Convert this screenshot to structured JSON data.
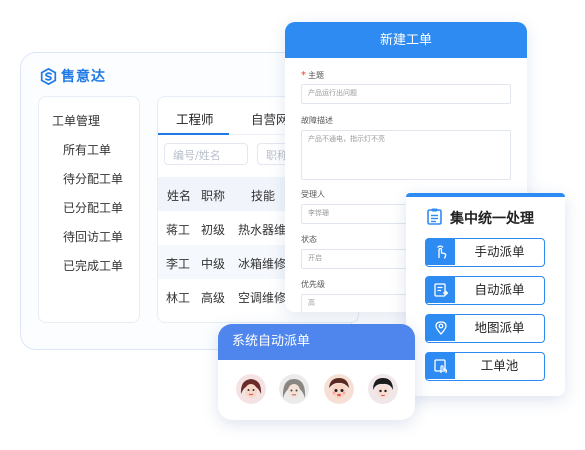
{
  "brand": {
    "name": "售意达"
  },
  "sidebar": {
    "header": "工单管理",
    "items": [
      {
        "label": "所有工单"
      },
      {
        "label": "待分配工单"
      },
      {
        "label": "已分配工单"
      },
      {
        "label": "待回访工单"
      },
      {
        "label": "已完成工单"
      }
    ]
  },
  "main": {
    "tabs": [
      {
        "label": "工程师"
      },
      {
        "label": "自营网..."
      }
    ],
    "search_placeholders": [
      "编号/姓名",
      "职称"
    ],
    "table": {
      "columns": [
        "姓名",
        "职称",
        "技能"
      ],
      "rows": [
        [
          "蒋工",
          "初级",
          "热水器维修"
        ],
        [
          "李工",
          "中级",
          "冰箱维修"
        ],
        [
          "林工",
          "高级",
          "空调维修"
        ]
      ]
    }
  },
  "modal": {
    "title": "新建工单",
    "fields": [
      {
        "label": "主题",
        "required": true,
        "value": "产品运行出问题"
      },
      {
        "label": "故障描述",
        "value": "产品不通电，指示灯不亮"
      },
      {
        "label": "受理人",
        "value": "李铧珊"
      },
      {
        "label": "状态",
        "value": "开启"
      },
      {
        "label": "优先级",
        "value": "高"
      }
    ]
  },
  "central": {
    "title": "集中统一处理",
    "icon": "document-list-icon",
    "buttons": [
      {
        "label": "手动派单",
        "icon": "hand-tap-icon"
      },
      {
        "label": "自动派单",
        "icon": "auto-doc-icon"
      },
      {
        "label": "地图派单",
        "icon": "map-pin-icon"
      },
      {
        "label": "工单池",
        "icon": "pool-touch-icon"
      }
    ]
  },
  "auto_dispatch": {
    "title": "系统自动派单",
    "avatars": [
      "avatar-1",
      "avatar-2",
      "avatar-3",
      "avatar-4"
    ]
  },
  "colors": {
    "primary": "#2e8bf2",
    "auto_header": "#4f86ee",
    "required": "#e53935"
  }
}
